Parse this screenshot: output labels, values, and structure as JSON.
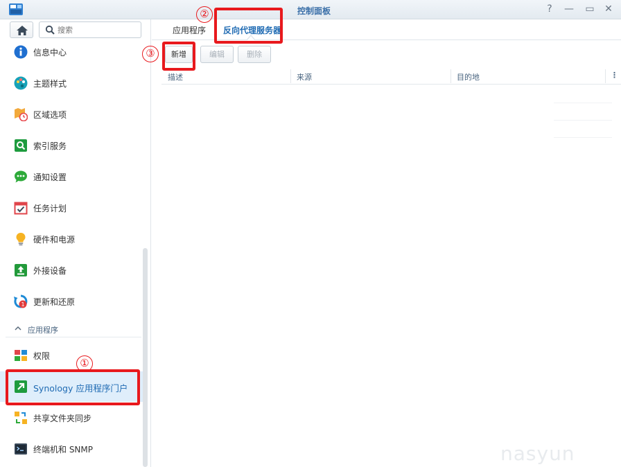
{
  "window": {
    "title": "控制面板",
    "controls": {
      "help": "?",
      "minimize": "—",
      "maximize": "▭",
      "close": "✕"
    }
  },
  "sidebar": {
    "search_placeholder": "搜索",
    "items": [
      {
        "label": "信息中心",
        "icon": "info-icon"
      },
      {
        "label": "主题样式",
        "icon": "palette-icon"
      },
      {
        "label": "区域选项",
        "icon": "region-clock-icon"
      },
      {
        "label": "索引服务",
        "icon": "index-search-icon"
      },
      {
        "label": "通知设置",
        "icon": "chat-bubble-icon"
      },
      {
        "label": "任务计划",
        "icon": "calendar-check-icon"
      },
      {
        "label": "硬件和电源",
        "icon": "lightbulb-icon"
      },
      {
        "label": "外接设备",
        "icon": "upload-device-icon"
      },
      {
        "label": "更新和还原",
        "icon": "update-restore-icon",
        "badge": "1"
      }
    ],
    "section_header": "应用程序",
    "app_items": [
      {
        "label": "权限",
        "icon": "permissions-icon"
      },
      {
        "label": "Synology 应用程序门户",
        "icon": "app-portal-icon",
        "active": true
      },
      {
        "label": "共享文件夹同步",
        "icon": "folder-sync-icon"
      },
      {
        "label": "终端机和 SNMP",
        "icon": "terminal-icon"
      }
    ]
  },
  "main": {
    "tabs": [
      {
        "label": "应用程序"
      },
      {
        "label": "反向代理服务器",
        "active": true
      }
    ],
    "toolbar": {
      "add": "新增",
      "edit": "编辑",
      "delete": "删除"
    },
    "columns": [
      "描述",
      "来源",
      "目的地"
    ],
    "column_menu": "⋮"
  },
  "annotations": {
    "one": "①",
    "two": "②",
    "three": "③"
  },
  "watermark": "nasyun",
  "colors": {
    "accent": "#1f6bb3",
    "highlight": "#e8191d",
    "active_bg": "#dfeefb"
  }
}
